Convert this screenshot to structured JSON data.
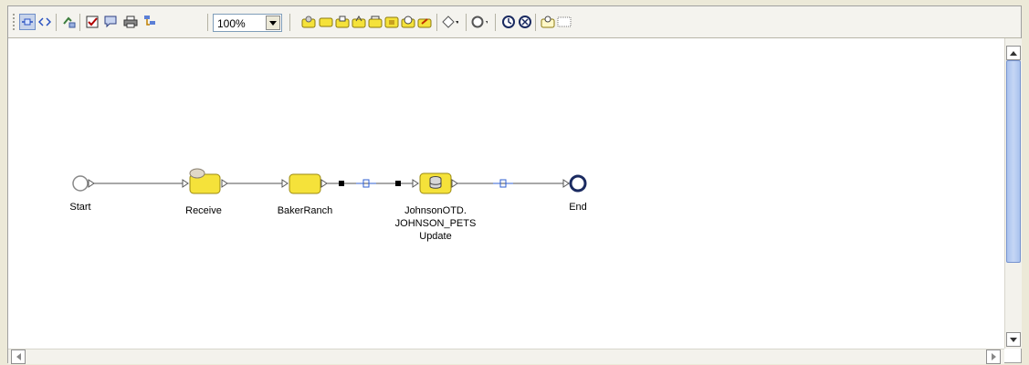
{
  "toolbar": {
    "zoom_value": "100%",
    "buttons": [
      "link-mode-icon",
      "code-view-icon",
      "connect-icon",
      "validate-icon",
      "comment-icon",
      "print-icon",
      "layout-icon",
      "receive-icon",
      "empty-activity-icon",
      "invoke-icon",
      "reply-icon",
      "throw-icon",
      "assign-icon",
      "wait-icon",
      "compensate-icon",
      "decision-icon",
      "merge-icon",
      "while-icon",
      "catch-all-icon",
      "event-icon",
      "scope-icon"
    ]
  },
  "nodes": {
    "start": "Start",
    "receive": "Receive",
    "baker": "BakerRanch",
    "johnson_line1": "JohnsonOTD.",
    "johnson_line2": "JOHNSON_PETS",
    "johnson_line3": "Update",
    "end": "End"
  },
  "colors": {
    "activity_fill": "#f5e23a",
    "activity_border": "#9b8a12",
    "flow_line": "#505050",
    "map_link": "#2f5fd0",
    "scroll_thumb": "#b8ccf2"
  }
}
